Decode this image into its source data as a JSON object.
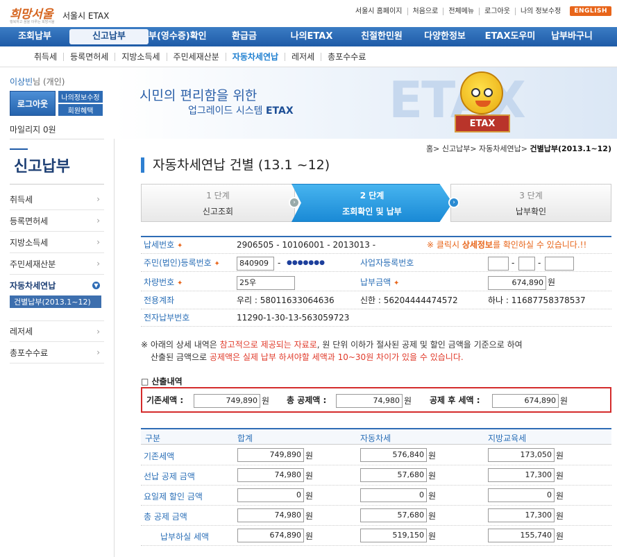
{
  "header": {
    "logo_text": "희망서울",
    "logo_sub": "행복하고 꿈을 이루는 희망서울",
    "site_name": "서울시 ETAX",
    "top_links": [
      "서울시 홈페이지",
      "처음으로",
      "전체메뉴",
      "로그아웃",
      "나의 정보수정"
    ],
    "english_label": "ENGLISH"
  },
  "main_nav": [
    "조회납부",
    "신고납부",
    "부(영수증)확인",
    "환급금",
    "나의ETAX",
    "친절한민원",
    "다양한정보",
    "ETAX도우미",
    "납부바구니"
  ],
  "sub_nav": [
    "취득세",
    "등록면허세",
    "지방소득세",
    "주민세재산분",
    "자동차세연납",
    "레저세",
    "총포수수료"
  ],
  "user": {
    "name": "이상빈",
    "suffix": "님 (개인)",
    "logout": "로그아웃",
    "myinfo": "나의정보수정",
    "benefit": "회원혜택",
    "mileage": "마일리지  0원"
  },
  "banner": {
    "line1": "시민의 편리함을 위한",
    "line2_prefix": "업그레이드 시스템 ",
    "line2_strong": "ETAX",
    "big_text": "ETAX",
    "sign_text": "ETAX"
  },
  "sidebar": {
    "title": "신고납부",
    "items": [
      "취득세",
      "등록면허세",
      "지방소득세",
      "주민세재산분",
      "자동차세연납",
      "레저세",
      "총포수수료"
    ],
    "sub_item": "건별납부(2013.1~12)"
  },
  "breadcrumb": {
    "prefix": "홈> 신고납부> 자동차세연납> ",
    "current": "건별납부(2013.1~12)"
  },
  "page_title": "자동차세연납 건별 (13.1 ~12)",
  "steps": [
    {
      "num": "1 단계",
      "title": "신고조회"
    },
    {
      "num": "2 단계",
      "title": "조회확인 및 납부"
    },
    {
      "num": "3 단계",
      "title": "납부확인"
    }
  ],
  "info": {
    "tax_no_label": "납세번호",
    "tax_no": "2906505 - 10106001 - 2013013 -",
    "tax_note_prefix": "※ 클릭시 ",
    "tax_note_strong": "상세정보",
    "tax_note_suffix": "를 확인하실 수 있습니다.!!",
    "rrn_label": "주민(법인)등록번호",
    "rrn_front": "840909",
    "rrn_dash": "-",
    "rrn_back": "●●●●●●●",
    "biz_label": "사업자등록번호",
    "biz_dash": "-",
    "car_label": "차량번호",
    "car_no": "25우",
    "pay_label": "납부금액",
    "pay_amount": "674,890",
    "won": "원",
    "account_label": "전용계좌",
    "accounts": [
      "우리 : 58011633064636",
      "신한 : 56204444474572",
      "하나 : 11687758378537"
    ],
    "epay_label": "전자납부번호",
    "epay_no": "11290-1-30-13-563059723"
  },
  "notice": {
    "p1": "※ 아래의 상세 내역은 ",
    "r1": "참고적으로 제공되는 자료로",
    "p2": ", 원 단위 이하가 절사된 공제 및 할인 금액을 기준으로 하여",
    "p3": "산출된 금액으로 ",
    "r2": "공제액은 실제 납부 하셔야할 세액과 10~30원 차이가 있을 수 있습니다."
  },
  "calc": {
    "heading": "□ 산출내역",
    "base_label": "기존세액 :",
    "base": "749,890",
    "deduct_label": "총 공제액 :",
    "deduct": "74,980",
    "after_label": "공제 후 세액 :",
    "after": "674,890",
    "won": "원"
  },
  "breakdown": {
    "headers": [
      "구분",
      "합계",
      "자동차세",
      "지방교육세"
    ],
    "won": "원",
    "rows": [
      {
        "label": "기존세액",
        "values": [
          "749,890",
          "576,840",
          "173,050"
        ]
      },
      {
        "label": "선납 공제 금액",
        "values": [
          "74,980",
          "57,680",
          "17,300"
        ]
      },
      {
        "label": "요일제 할인 금액",
        "values": [
          "0",
          "0",
          "0"
        ]
      },
      {
        "label": "총 공제 금액",
        "values": [
          "74,980",
          "57,680",
          "17,300"
        ]
      },
      {
        "label": "납부하실 세액",
        "values": [
          "674,890",
          "519,150",
          "155,740"
        ]
      }
    ]
  },
  "colors": {
    "primary": "#1f5ba7",
    "accent": "#e8651a",
    "alert": "#d42b2b",
    "step_active": "#1a8ad6"
  }
}
